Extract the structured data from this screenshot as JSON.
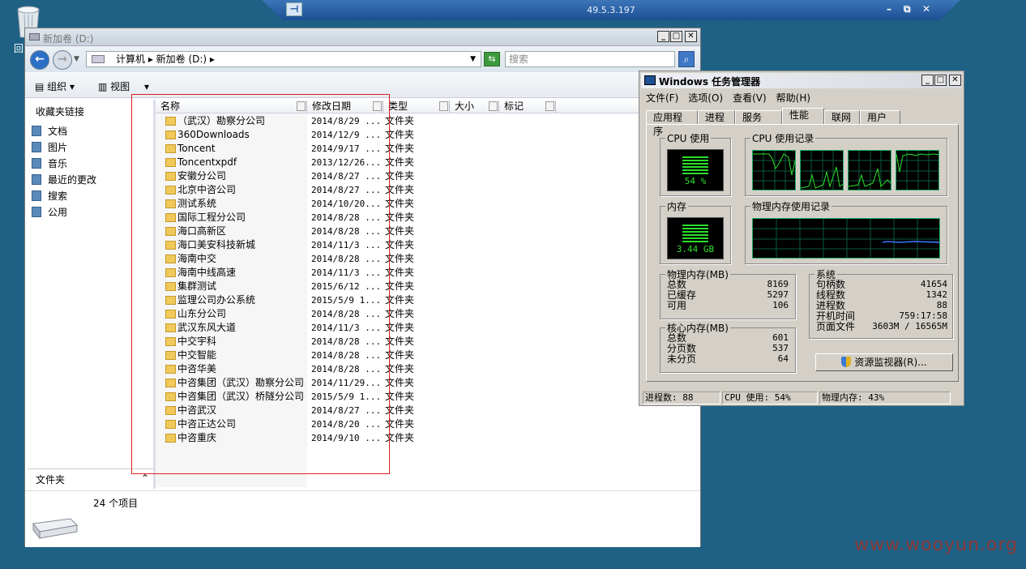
{
  "remote": {
    "ip": "49.5.3.197",
    "pin": "⊣",
    "min": "–",
    "restore": "⧉",
    "close": "✕"
  },
  "desktop": {
    "recycle_label": "回",
    "watermark": "www.wooyun.org"
  },
  "explorer": {
    "title": "新加卷  (D:)",
    "address": "计算机 ▸ 新加卷 (D:) ▸",
    "search_placeholder": "搜索",
    "toolbar": {
      "organize": "组织",
      "views": "视图"
    },
    "nav_header": "收藏夹链接",
    "nav_items": [
      "文档",
      "图片",
      "音乐",
      "最近的更改",
      "搜索",
      "公用"
    ],
    "folders_label": "文件夹",
    "columns": [
      "名称",
      "修改日期",
      "类型",
      "大小",
      "标记"
    ],
    "rows": [
      [
        "（武汉）勘察分公司",
        "2014/8/29 ..."
      ],
      [
        "360Downloads",
        "2014/12/9 ..."
      ],
      [
        "Toncent",
        "2014/9/17 ..."
      ],
      [
        "Toncentxpdf",
        "2013/12/26..."
      ],
      [
        "安徽分公司",
        "2014/8/27 ..."
      ],
      [
        "北京中咨公司",
        "2014/8/27 ..."
      ],
      [
        "测试系统",
        "2014/10/20..."
      ],
      [
        "国际工程分公司",
        "2014/8/28 ..."
      ],
      [
        "海口高新区",
        "2014/8/28 ..."
      ],
      [
        "海口美安科技新城",
        "2014/11/3 ..."
      ],
      [
        "海南中交",
        "2014/8/28 ..."
      ],
      [
        "海南中线高速",
        "2014/11/3 ..."
      ],
      [
        "集群测试",
        "2015/6/12 ..."
      ],
      [
        "监理公司办公系统",
        "2015/5/9 1..."
      ],
      [
        "山东分公司",
        "2014/8/28 ..."
      ],
      [
        "武汉东风大道",
        "2014/11/3 ..."
      ],
      [
        "中交宇科",
        "2014/8/28 ..."
      ],
      [
        "中交智能",
        "2014/8/28 ..."
      ],
      [
        "中咨华美",
        "2014/8/28 ..."
      ],
      [
        "中咨集团（武汉）勘察分公司",
        "2014/11/29..."
      ],
      [
        "中咨集团（武汉）桥隧分公司",
        "2015/5/9 1..."
      ],
      [
        "中咨武汉",
        "2014/8/27 ..."
      ],
      [
        "中咨正达公司",
        "2014/8/20 ..."
      ],
      [
        "中咨重庆",
        "2014/9/10 ..."
      ]
    ],
    "row_type": "文件夹",
    "status": "24 个项目"
  },
  "taskmgr": {
    "title": "Windows 任务管理器",
    "menu": [
      "文件(F)",
      "选项(O)",
      "查看(V)",
      "帮助(H)"
    ],
    "tabs": [
      "应用程序",
      "进程",
      "服务",
      "性能",
      "联网",
      "用户"
    ],
    "cpu_usage_label": "CPU 使用",
    "cpu_usage_value": "54 %",
    "cpu_history_label": "CPU 使用记录",
    "mem_label": "内存",
    "mem_value": "3.44 GB",
    "mem_history_label": "物理内存使用记录",
    "phys": {
      "label": "物理内存(MB)",
      "items": [
        [
          "总数",
          "8169"
        ],
        [
          "已缓存",
          "5297"
        ],
        [
          "可用",
          "106"
        ]
      ]
    },
    "kernel": {
      "label": "核心内存(MB)",
      "items": [
        [
          "总数",
          "601"
        ],
        [
          "分页数",
          "537"
        ],
        [
          "未分页",
          "64"
        ]
      ]
    },
    "system": {
      "label": "系统",
      "items": [
        [
          "句柄数",
          "41654"
        ],
        [
          "线程数",
          "1342"
        ],
        [
          "进程数",
          "88"
        ],
        [
          "开机时间",
          "759:17:58"
        ],
        [
          "页面文件",
          "3603M / 16565M"
        ]
      ]
    },
    "resource_button": "资源监视器(R)...",
    "status": {
      "procs": "进程数: 88",
      "cpu": "CPU 使用: 54%",
      "mem": "物理内存: 43%"
    }
  }
}
